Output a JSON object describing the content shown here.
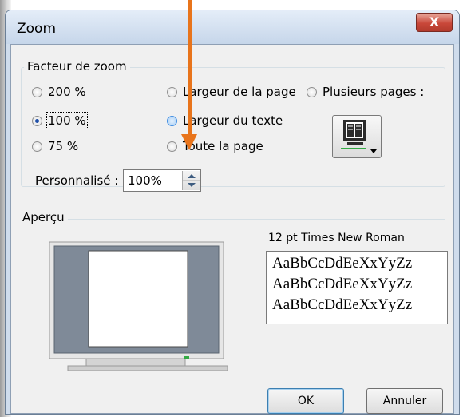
{
  "window": {
    "title": "Zoom",
    "close_label": "X"
  },
  "zoom_group": {
    "label": "Facteur de zoom",
    "options": {
      "p200": "200 %",
      "p100": "100 %",
      "p75": "75 %",
      "page_width": "Largeur de la page",
      "text_width": "Largeur du texte",
      "whole_page": "Toute la page",
      "many_pages": "Plusieurs pages :"
    },
    "selected": "100 %"
  },
  "custom": {
    "label": "Personnalisé :",
    "value": "100%"
  },
  "preview": {
    "label": "Aperçu",
    "font_name": "12 pt Times New Roman",
    "sample_lines": [
      "AaBbCcDdEeXxYyZz",
      "AaBbCcDdEeXxYyZz",
      "AaBbCcDdEeXxYyZz"
    ]
  },
  "buttons": {
    "ok": "OK",
    "cancel": "Annuler"
  },
  "icons": [
    "close-icon",
    "multiple-pages-icon",
    "spin-up-icon",
    "spin-down-icon",
    "monitor-preview-icon",
    "annotation-arrow"
  ],
  "colors": {
    "accent_arrow": "#e8741b",
    "close_button": "#c9483a",
    "dialog_bg": "#f0f0f0"
  }
}
